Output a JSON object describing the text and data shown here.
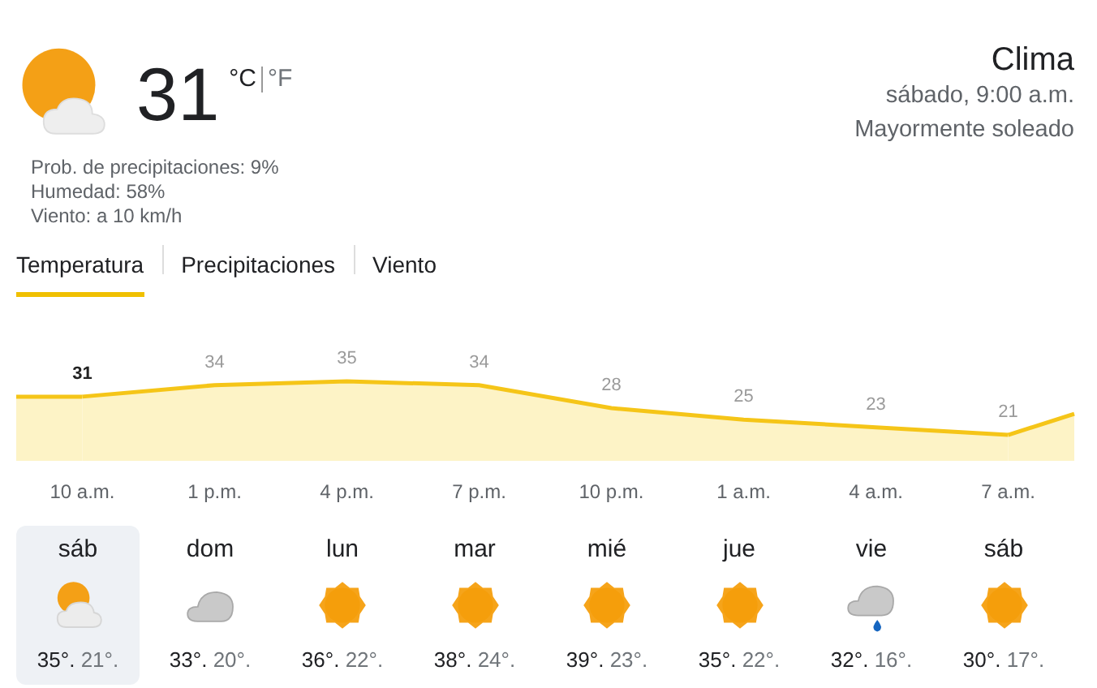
{
  "current": {
    "icon": {
      "kind": "partly-sunny"
    },
    "temperature": "31",
    "units": [
      {
        "label": "°C",
        "selected": true
      },
      {
        "label": "°F",
        "selected": false
      }
    ],
    "details": [
      "Prob. de precipitaciones: 9%",
      "Humedad: 58%",
      "Viento: a 10 km/h"
    ]
  },
  "location": {
    "title": "Clima",
    "time": "sábado, 9:00 a.m.",
    "condition": "Mayormente soleado"
  },
  "tabs": [
    {
      "label": "Temperatura",
      "selected": true
    },
    {
      "label": "Precipitaciones",
      "selected": false
    },
    {
      "label": "Viento",
      "selected": false
    }
  ],
  "chart_data": {
    "type": "area",
    "categories": [
      "10 a.m.",
      "1 p.m.",
      "4 p.m.",
      "7 p.m.",
      "10 p.m.",
      "1 a.m.",
      "4 a.m.",
      "7 a.m."
    ],
    "values": [
      31,
      34,
      35,
      34,
      28,
      25,
      23,
      21
    ],
    "data_labels": true
  },
  "days": [
    {
      "name": "sáb",
      "kind": "partly-sunny",
      "high": "35°.",
      "low": "21°.",
      "selected": true
    },
    {
      "name": "dom",
      "kind": "cloudy",
      "high": "33°.",
      "low": "20°.",
      "selected": false
    },
    {
      "name": "lun",
      "kind": "sunny",
      "high": "36°.",
      "low": "22°.",
      "selected": false
    },
    {
      "name": "mar",
      "kind": "sunny",
      "high": "38°.",
      "low": "24°.",
      "selected": false
    },
    {
      "name": "mié",
      "kind": "sunny",
      "high": "39°.",
      "low": "23°.",
      "selected": false
    },
    {
      "name": "jue",
      "kind": "sunny",
      "high": "35°.",
      "low": "22°.",
      "selected": false
    },
    {
      "name": "vie",
      "kind": "rain",
      "high": "32°.",
      "low": "16°.",
      "selected": false
    },
    {
      "name": "sáb",
      "kind": "sunny",
      "high": "30°.",
      "low": "17°.",
      "selected": false
    }
  ]
}
